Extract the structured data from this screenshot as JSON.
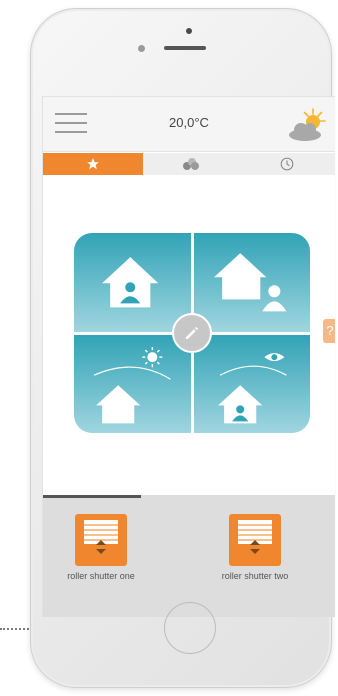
{
  "header": {
    "temperature": "20,0°C"
  },
  "icons": {
    "menu": "hamburger-icon",
    "weather": "partly-cloudy-icon",
    "help": "?"
  },
  "tabs": [
    {
      "icon": "star-icon",
      "active": true
    },
    {
      "icon": "group-icon",
      "active": false
    },
    {
      "icon": "clock-icon",
      "active": false
    }
  ],
  "scenes": [
    {
      "icon": "house-person-icon"
    },
    {
      "icon": "person-away-icon"
    },
    {
      "icon": "house-sun-icon"
    },
    {
      "icon": "house-eye-icon"
    }
  ],
  "devices": [
    {
      "label": "roller shutter one"
    },
    {
      "label": "roller shutter two"
    }
  ],
  "colors": {
    "accent": "#f0872f",
    "tile": "#31a3b6"
  }
}
